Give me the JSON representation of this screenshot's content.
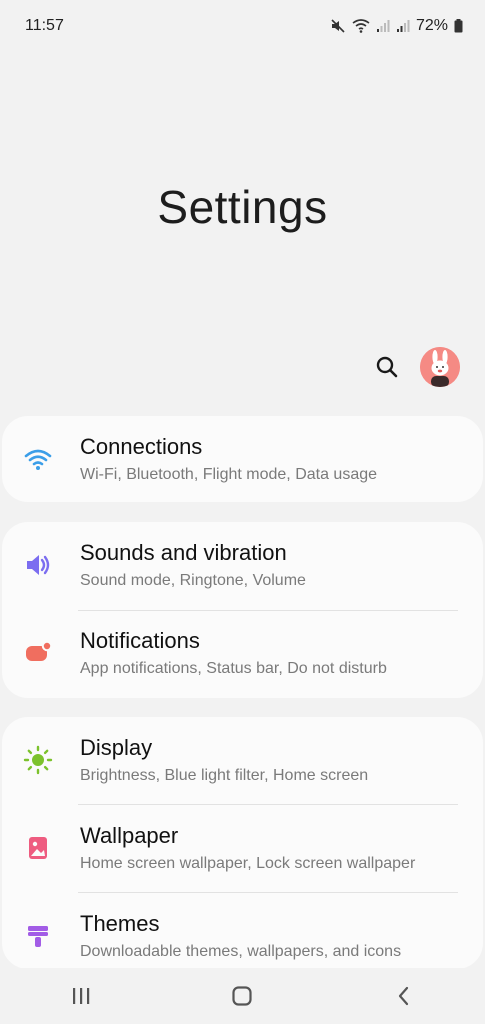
{
  "status_bar": {
    "time": "11:57",
    "battery": "72%"
  },
  "page": {
    "title": "Settings"
  },
  "colors": {
    "background": "#f2f2f2",
    "card": "#fbfbfb",
    "connections_icon": "#3b9ee8",
    "sounds_icon": "#7b6df0",
    "notifications_icon": "#f06e5f",
    "display_icon": "#7cc22c",
    "wallpaper_icon": "#ee5c80",
    "themes_icon": "#a25ce6"
  },
  "settings": [
    {
      "title": "Connections",
      "subtitle": "Wi-Fi, Bluetooth, Flight mode, Data usage",
      "icon": "wifi-icon"
    },
    {
      "title": "Sounds and vibration",
      "subtitle": "Sound mode, Ringtone, Volume",
      "icon": "speaker-icon"
    },
    {
      "title": "Notifications",
      "subtitle": "App notifications, Status bar, Do not disturb",
      "icon": "notification-icon"
    },
    {
      "title": "Display",
      "subtitle": "Brightness, Blue light filter, Home screen",
      "icon": "sun-icon"
    },
    {
      "title": "Wallpaper",
      "subtitle": "Home screen wallpaper, Lock screen wallpaper",
      "icon": "image-icon"
    },
    {
      "title": "Themes",
      "subtitle": "Downloadable themes, wallpapers, and icons",
      "icon": "brush-icon"
    }
  ],
  "nav": {
    "recent_icon": "recent-apps-icon",
    "home_icon": "home-icon",
    "back_icon": "back-icon"
  }
}
